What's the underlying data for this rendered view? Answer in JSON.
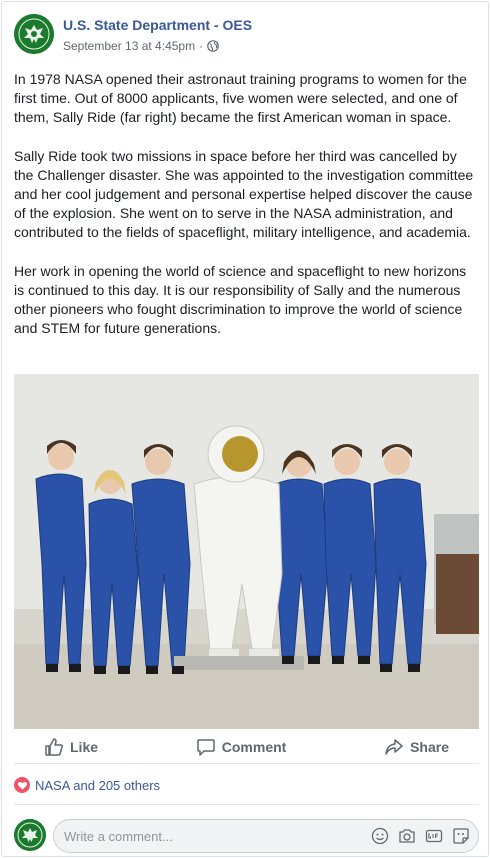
{
  "post": {
    "page_name": "U.S. State Department - OES",
    "timestamp": "September 13 at 4:45pm",
    "separator": "·",
    "paragraphs": [
      "In 1978 NASA opened their astronaut training programs to women for the first time. Out of 8000 applicants, five women were selected, and one of them, Sally Ride (far right) became the first American woman in space.",
      "Sally Ride took two missions in space before her third was cancelled by the Challenger disaster. She was appointed to the investigation committee and her cool judgement and personal expertise helped discover the cause of the explosion. She went on to serve in the NASA administration, and contributed to the fields of spaceflight, military intelligence, and academia.",
      "Her work in opening the world of science and spaceflight to new horizons is continued to this day. It is our responsibility of Sally and the numerous other pioneers who fought discrimination to improve the world of science and STEM for future generations."
    ]
  },
  "actions": {
    "like": "Like",
    "comment": "Comment",
    "share": "Share"
  },
  "reactions": {
    "summary": "NASA and 205 others",
    "type": "heart-icon"
  },
  "comment_box": {
    "placeholder": "Write a comment..."
  },
  "colors": {
    "link": "#385898",
    "text": "#1c1e21",
    "secondary": "#616770",
    "heart": "#f25268",
    "seal_green": "#1b7a2e"
  }
}
